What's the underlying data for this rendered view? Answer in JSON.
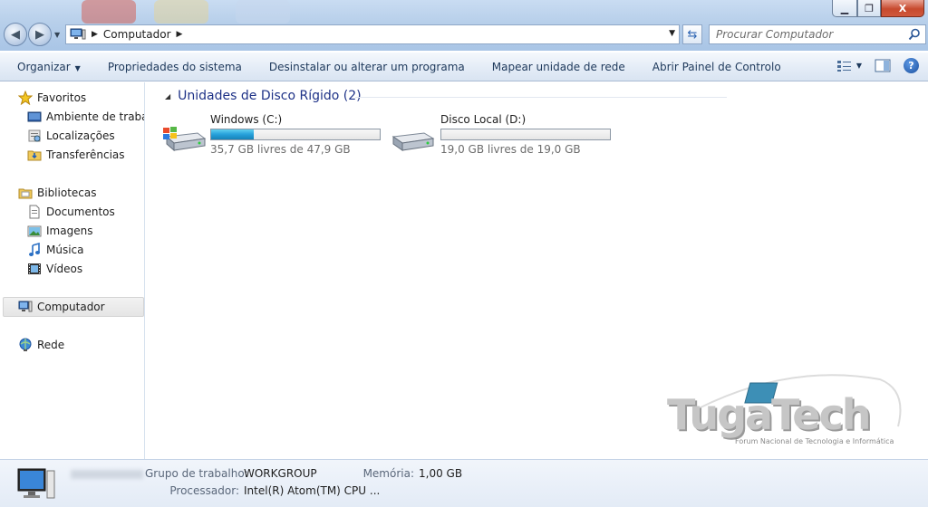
{
  "window": {
    "min": "▁",
    "max": "❐",
    "close": "X"
  },
  "address": {
    "location": "Computador"
  },
  "search": {
    "placeholder": "Procurar Computador"
  },
  "toolbar": {
    "organize": "Organizar",
    "system_properties": "Propriedades do sistema",
    "uninstall": "Desinstalar ou alterar um programa",
    "map_drive": "Mapear unidade de rede",
    "control_panel": "Abrir Painel de Controlo",
    "help": "?"
  },
  "sidebar": {
    "favorites": {
      "label": "Favoritos",
      "items": [
        "Ambiente de trabalho",
        "Localizações",
        "Transferências"
      ]
    },
    "libraries": {
      "label": "Bibliotecas",
      "items": [
        "Documentos",
        "Imagens",
        "Música",
        "Vídeos"
      ]
    },
    "computer": "Computador",
    "network": "Rede"
  },
  "content": {
    "group_title": "Unidades de Disco Rígido (2)",
    "drives": [
      {
        "name": "Windows (C:)",
        "free": "35,7 GB livres de 47,9 GB",
        "used_fraction": 0.255
      },
      {
        "name": "Disco Local (D:)",
        "free": "19,0 GB livres de 19,0 GB",
        "used_fraction": 0.0
      }
    ]
  },
  "watermark": {
    "brand": "TugaTech",
    "tagline": "Forum Nacional de Tecnologia e Informática"
  },
  "details": {
    "workgroup_label": "Grupo de trabalho:",
    "workgroup_value": "WORKGROUP",
    "memory_label": "Memória:",
    "memory_value": "1,00 GB",
    "processor_label": "Processador:",
    "processor_value": "Intel(R) Atom(TM) CPU ..."
  },
  "colors": {
    "accent": "#1e3287",
    "bar_fill": "#26a0da",
    "toolbar_text": "#1e395b"
  }
}
